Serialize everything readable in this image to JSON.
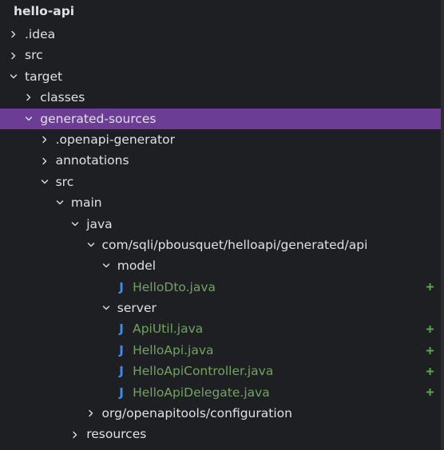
{
  "project": {
    "title": "hello-api"
  },
  "colors": {
    "selected_row": "#6c3d94",
    "text": "#dfe1e5",
    "java_file_text": "#73a35f",
    "java_icon": "#3d8df5",
    "added_marker": "#57a64a",
    "background": "#1e1f22"
  },
  "tree": [
    {
      "label": ".idea",
      "depth": 0,
      "state": "collapsed",
      "icon": "chevron-right-icon"
    },
    {
      "label": "src",
      "depth": 0,
      "state": "collapsed",
      "icon": "chevron-right-icon"
    },
    {
      "label": "target",
      "depth": 0,
      "state": "expanded",
      "icon": "chevron-down-icon"
    },
    {
      "label": "classes",
      "depth": 1,
      "state": "collapsed",
      "icon": "chevron-right-icon"
    },
    {
      "label": "generated-sources",
      "depth": 1,
      "state": "expanded",
      "icon": "chevron-down-icon",
      "selected": true
    },
    {
      "label": ".openapi-generator",
      "depth": 2,
      "state": "collapsed",
      "icon": "chevron-right-icon"
    },
    {
      "label": "annotations",
      "depth": 2,
      "state": "collapsed",
      "icon": "chevron-right-icon"
    },
    {
      "label": "src",
      "depth": 2,
      "state": "expanded",
      "icon": "chevron-down-icon"
    },
    {
      "label": "main",
      "depth": 3,
      "state": "expanded",
      "icon": "chevron-down-icon"
    },
    {
      "label": "java",
      "depth": 4,
      "state": "expanded",
      "icon": "chevron-down-icon"
    },
    {
      "label": "com/sqli/pbousquet/helloapi/generated/api",
      "depth": 5,
      "state": "expanded",
      "icon": "chevron-down-icon"
    },
    {
      "label": "model",
      "depth": 6,
      "state": "expanded",
      "icon": "chevron-down-icon"
    },
    {
      "label": "HelloDto.java",
      "depth": 7,
      "type": "java",
      "icon": "java-class-icon",
      "glyph": "J",
      "added": true
    },
    {
      "label": "server",
      "depth": 6,
      "state": "expanded",
      "icon": "chevron-down-icon"
    },
    {
      "label": "ApiUtil.java",
      "depth": 7,
      "type": "java",
      "icon": "java-class-icon",
      "glyph": "J",
      "added": true
    },
    {
      "label": "HelloApi.java",
      "depth": 7,
      "type": "java",
      "icon": "java-class-icon",
      "glyph": "J",
      "added": true
    },
    {
      "label": "HelloApiController.java",
      "depth": 7,
      "type": "java",
      "icon": "java-class-icon",
      "glyph": "J",
      "added": true
    },
    {
      "label": "HelloApiDelegate.java",
      "depth": 7,
      "type": "java",
      "icon": "java-class-icon",
      "glyph": "J",
      "added": true
    },
    {
      "label": "org/openapitools/configuration",
      "depth": 5,
      "state": "collapsed",
      "icon": "chevron-right-icon"
    },
    {
      "label": "resources",
      "depth": 4,
      "state": "collapsed",
      "icon": "chevron-right-icon"
    }
  ]
}
